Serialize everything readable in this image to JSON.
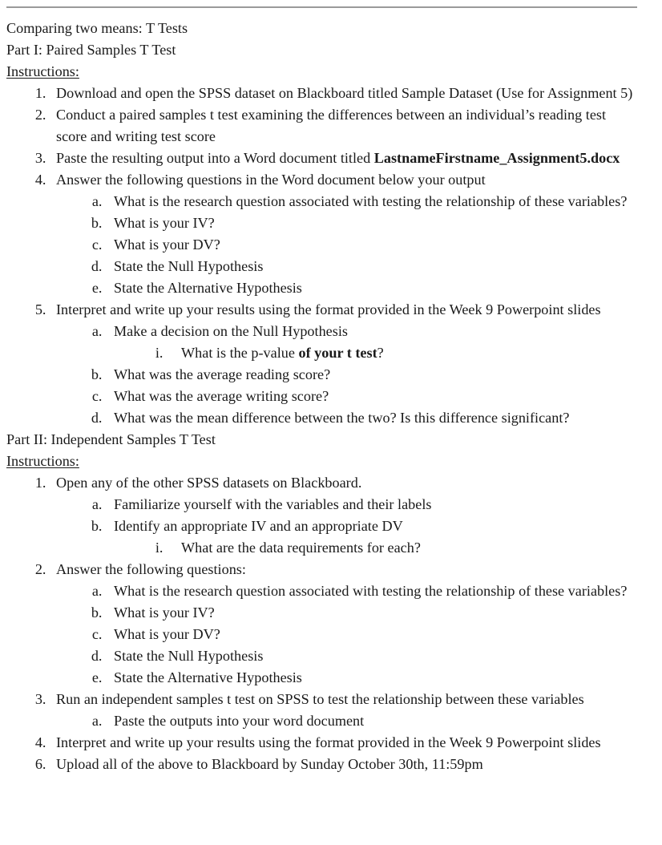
{
  "document": {
    "title_line": "Comparing two means: T Tests",
    "rule_color": "#9a9a9a",
    "text_color": "#1a1a1a",
    "background_color": "#ffffff",
    "part1": {
      "heading": "Part I: Paired Samples T Test",
      "instructions_label": "Instructions:",
      "items": [
        {
          "number": "1",
          "text": "Download and open the SPSS dataset on Blackboard titled Sample Dataset (Use for Assignment 5)"
        },
        {
          "number": "2",
          "text": "Conduct a paired samples t test examining the differences between an individual’s reading test score and writing test score"
        },
        {
          "number": "3",
          "text_before": "Paste the resulting output into a Word document titled ",
          "text_bold": "LastnameFirstname_Assignment5.docx",
          "text_after": ""
        },
        {
          "number": "4",
          "text": "Answer the following questions in the Word document below your output",
          "sub": [
            {
              "letter": "a",
              "text": "What is the research question associated with testing the relationship of these variables?"
            },
            {
              "letter": "b",
              "text": "What is your IV?"
            },
            {
              "letter": "c",
              "text": "What is your DV?"
            },
            {
              "letter": "d",
              "text": "State the Null Hypothesis"
            },
            {
              "letter": "e",
              "text": "State the Alternative Hypothesis"
            }
          ]
        },
        {
          "number": "5",
          "text": "Interpret and write up your results using the format provided in the Week 9 Powerpoint slides",
          "sub": [
            {
              "letter": "a",
              "text": "Make a decision on the Null Hypothesis",
              "sub": [
                {
                  "roman": "i",
                  "text_before": "What is the p-value ",
                  "text_bold": "of your t test",
                  "text_after": "?"
                }
              ]
            },
            {
              "letter": "b",
              "text": "What was the average reading score?"
            },
            {
              "letter": "c",
              "text": "What was the average writing score?"
            },
            {
              "letter": "d",
              "text": "What was the mean difference between the two? Is this difference significant?"
            }
          ]
        }
      ]
    },
    "part2": {
      "heading": "Part II: Independent Samples T Test",
      "instructions_label": "Instructions:",
      "items": [
        {
          "number": "1",
          "text": "Open any of the other SPSS datasets on Blackboard.",
          "sub": [
            {
              "letter": "a",
              "text": "Familiarize yourself with the variables and their labels"
            },
            {
              "letter": "b",
              "text": "Identify an appropriate IV and an appropriate DV",
              "sub": [
                {
                  "roman": "i",
                  "text": "What are the data requirements for each?"
                }
              ]
            }
          ]
        },
        {
          "number": "2",
          "text": "Answer the following questions:",
          "sub": [
            {
              "letter": "a",
              "text": "What is the research question associated with testing the relationship of these variables?"
            },
            {
              "letter": "b",
              "text": "What is your IV?"
            },
            {
              "letter": "c",
              "text": "What is your DV?"
            },
            {
              "letter": "d",
              "text": "State the Null Hypothesis"
            },
            {
              "letter": "e",
              "text": "State the Alternative Hypothesis"
            }
          ]
        },
        {
          "number": "3",
          "text": "Run an independent samples t test on SPSS to test the relationship between these variables",
          "sub": [
            {
              "letter": "a",
              "text": "Paste the outputs into your word document"
            }
          ]
        },
        {
          "number": "4",
          "text": "Interpret and write up your results using the format provided in the Week 9 Powerpoint slides"
        },
        {
          "number": "6",
          "text": "Upload all of the above to Blackboard by Sunday October 30th, 11:59pm"
        }
      ]
    }
  }
}
